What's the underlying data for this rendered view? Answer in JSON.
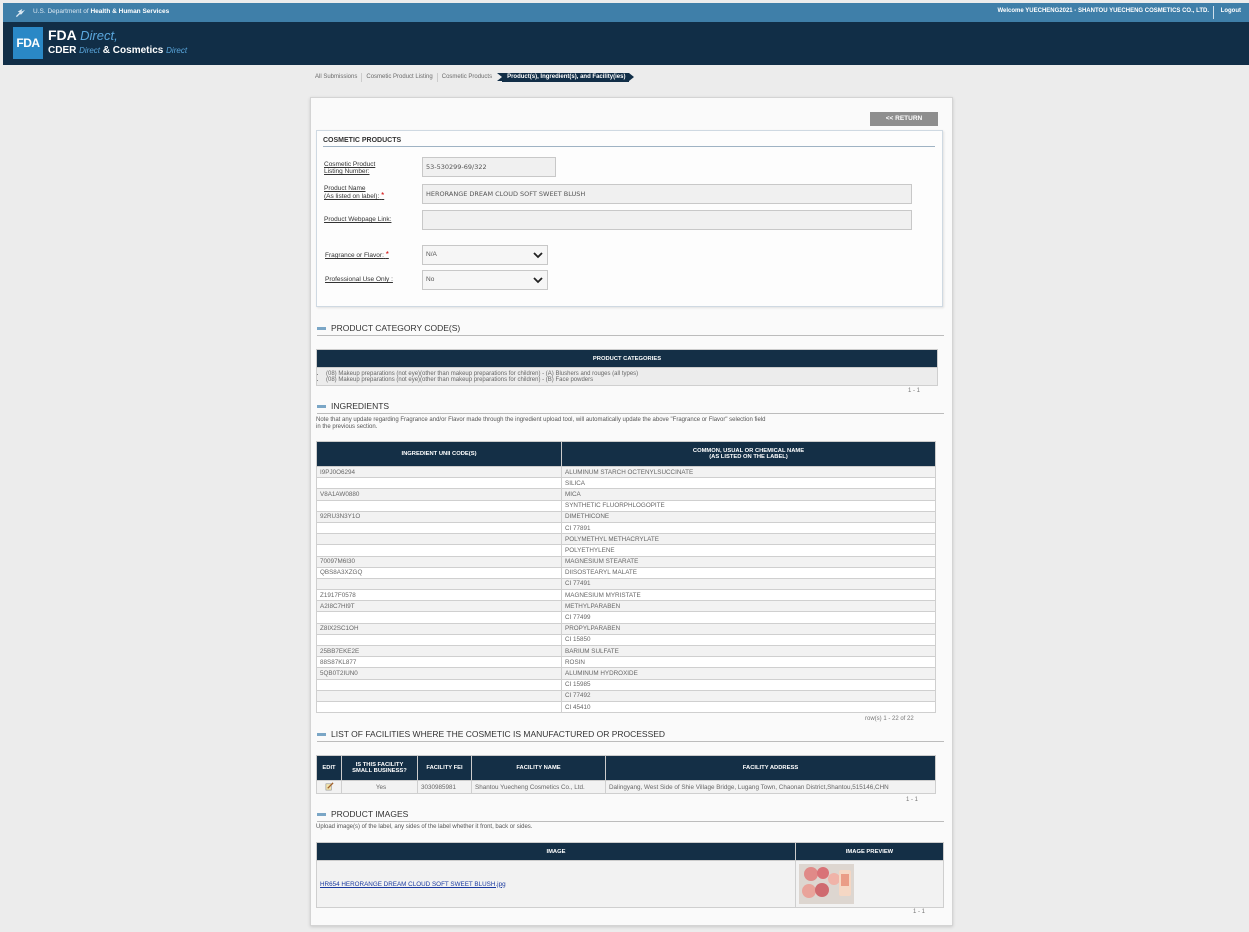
{
  "top_bar": {
    "agency": "U.S. Department of ",
    "agency_bold": "Health & Human Services",
    "welcome": "Welcome YUECHENG2021 - SHANTOU YUECHENG COSMETICS CO., LTD.",
    "logout": "Logout"
  },
  "header": {
    "logo": "FDA",
    "fda": "FDA ",
    "direct": "Direct,",
    "cder": "CDER ",
    "cder_direct": "Direct",
    "amp": " & ",
    "cosmetics": "Cosmetics ",
    "cosmetics_direct": "Direct"
  },
  "breadcrumb": [
    "All Submissions",
    "Cosmetic Product Listing",
    "Cosmetic Products",
    "Product(s), Ingredient(s), and Facility(ies)"
  ],
  "return_label": "<< RETURN",
  "cosmetic_products": {
    "title": "COSMETIC PRODUCTS",
    "listing_label_1": "Cosmetic Product",
    "listing_label_2": "Listing Number:",
    "listing_value": "53-530299-69/322",
    "name_label_1": "Product Name",
    "name_label_2": "(As listed on label):",
    "name_value": "HERORANGE DREAM CLOUD SOFT SWEET BLUSH",
    "webpage_label": "Product Webpage Link:",
    "webpage_value": "",
    "fragrance_label": "Fragrance or Flavor:",
    "fragrance_value": "N/A",
    "professional_label": "Professional Use Only :",
    "professional_value": "No",
    "required_mark": "*"
  },
  "category_section": {
    "title": "PRODUCT CATEGORY CODE(S)",
    "header": "PRODUCT CATEGORIES",
    "items": [
      "(08) Makeup preparations (not eye)(other than makeup preparations for children) - (A) Blushers and rouges (all types)",
      "(08) Makeup preparations (not eye)(other than makeup preparations for children) - (B) Face powders"
    ],
    "pager": "1 - 1"
  },
  "ingredients_section": {
    "title": "INGREDIENTS",
    "note_1": "Note that any update regarding Fragrance and/or Flavor made through the ingredient upload tool, will automatically update the above \"Fragrance or Flavor\" selection field",
    "note_2": "in the previous section.",
    "col_unii": "INGREDIENT UNII CODE(S)",
    "col_name_1": "COMMON, USUAL OR CHEMICAL NAME",
    "col_name_2": "(AS LISTED ON THE LABEL)",
    "rows": [
      {
        "unii": "I9PJ0O6294",
        "name": "ALUMINUM STARCH OCTENYLSUCCINATE"
      },
      {
        "unii": "",
        "name": "SILICA"
      },
      {
        "unii": "V8A1AW0880",
        "name": "MICA"
      },
      {
        "unii": "",
        "name": "SYNTHETIC FLUORPHLOGOPITE"
      },
      {
        "unii": "92RU3N3Y1O",
        "name": "DIMETHICONE"
      },
      {
        "unii": "",
        "name": "CI 77891"
      },
      {
        "unii": "",
        "name": "POLYMETHYL METHACRYLATE"
      },
      {
        "unii": "",
        "name": "POLYETHYLENE"
      },
      {
        "unii": "70097M6I30",
        "name": "MAGNESIUM STEARATE"
      },
      {
        "unii": "QBS8A3XZGQ",
        "name": "DIISOSTEARYL MALATE"
      },
      {
        "unii": "",
        "name": "CI 77491"
      },
      {
        "unii": "Z1917F0578",
        "name": "MAGNESIUM MYRISTATE"
      },
      {
        "unii": "A2I8C7HI9T",
        "name": "METHYLPARABEN"
      },
      {
        "unii": "",
        "name": "CI 77499"
      },
      {
        "unii": "Z8IX2SC1OH",
        "name": "PROPYLPARABEN"
      },
      {
        "unii": "",
        "name": "CI 15850"
      },
      {
        "unii": "25BB7EKE2E",
        "name": "BARIUM SULFATE"
      },
      {
        "unii": "88S87KL877",
        "name": "ROSIN"
      },
      {
        "unii": "5QB0T2IUN0",
        "name": "ALUMINUM HYDROXIDE"
      },
      {
        "unii": "",
        "name": "CI 15985"
      },
      {
        "unii": "",
        "name": "CI 77492"
      },
      {
        "unii": "",
        "name": "CI 45410"
      }
    ],
    "pager": "row(s) 1 - 22 of 22"
  },
  "facilities_section": {
    "title": "LIST OF FACILITIES WHERE THE COSMETIC IS MANUFACTURED OR PROCESSED",
    "col_edit": "EDIT",
    "col_small_1": "IS THIS FACILITY",
    "col_small_2": "SMALL BUSINESS?",
    "col_fei": "FACILITY FEI",
    "col_name": "FACILITY NAME",
    "col_address": "FACILITY ADDRESS",
    "row": {
      "small": "Yes",
      "fei": "3030985981",
      "name": "Shantou Yuecheng Cosmetics Co., Ltd.",
      "address": "Dalingyang, West Side of Shie Village Bridge, Lugang Town, Chaonan District,Shantou,515146,CHN"
    },
    "pager": "1 - 1"
  },
  "images_section": {
    "title": "PRODUCT IMAGES",
    "note": "Upload image(s) of the label, any sides of the label whether it front, back or sides.",
    "col_image": "IMAGE",
    "col_preview": "IMAGE PREVIEW",
    "file_name": "HR654 HERORANGE DREAM CLOUD SOFT SWEET BLUSH.jpg",
    "pager": "1 - 1"
  }
}
